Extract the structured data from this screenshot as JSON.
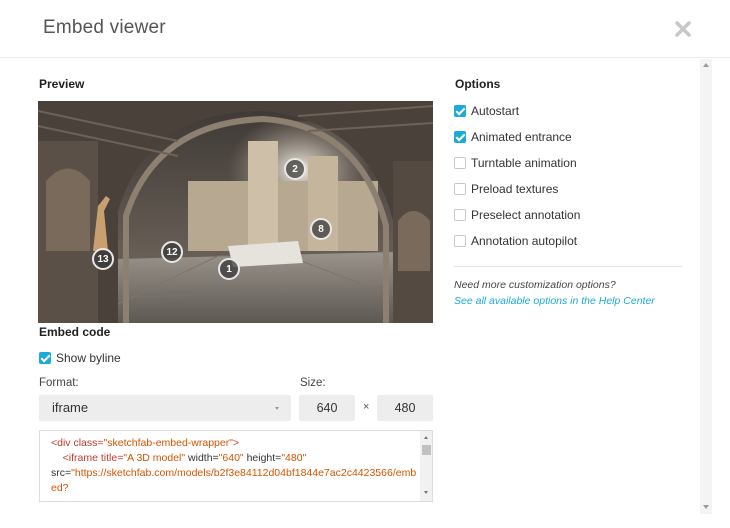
{
  "dialog": {
    "title": "Embed viewer",
    "close_icon": "close-icon"
  },
  "preview": {
    "label": "Preview",
    "hotspots": [
      "2",
      "8",
      "12",
      "13",
      "1"
    ]
  },
  "options": {
    "label": "Options",
    "items": [
      {
        "label": "Autostart",
        "checked": true
      },
      {
        "label": "Animated entrance",
        "checked": true
      },
      {
        "label": "Turntable animation",
        "checked": false
      },
      {
        "label": "Preload textures",
        "checked": false
      },
      {
        "label": "Preselect annotation",
        "checked": false
      },
      {
        "label": "Annotation autopilot",
        "checked": false
      }
    ],
    "help_text": "Need more customization options?",
    "help_link": "See all available options in the Help Center"
  },
  "embed": {
    "label": "Embed code",
    "show_byline": {
      "label": "Show byline",
      "checked": true
    },
    "format_label": "Format:",
    "format_value": "iframe",
    "size_label": "Size:",
    "width": "640",
    "times": "×",
    "height": "480",
    "code": {
      "l1_open": "<div class=",
      "l1_val": "\"sketchfab-embed-wrapper\"",
      "l1_close": ">",
      "l2_open": "    <iframe title=",
      "l2_title": "\"A 3D model\"",
      "l2_w": " width=",
      "l2_wval": "\"640\"",
      "l2_h": " height=",
      "l2_hval": "\"480\"",
      "l3_src": "src=",
      "l3_url": "\"https://sketchfab.com/models/b2f3e84112d04bf1844e7ac2c4423566/embed?"
    }
  },
  "colors": {
    "accent": "#1caad9",
    "checkbox_on": "#1caad9",
    "field_bg": "#ededed"
  }
}
